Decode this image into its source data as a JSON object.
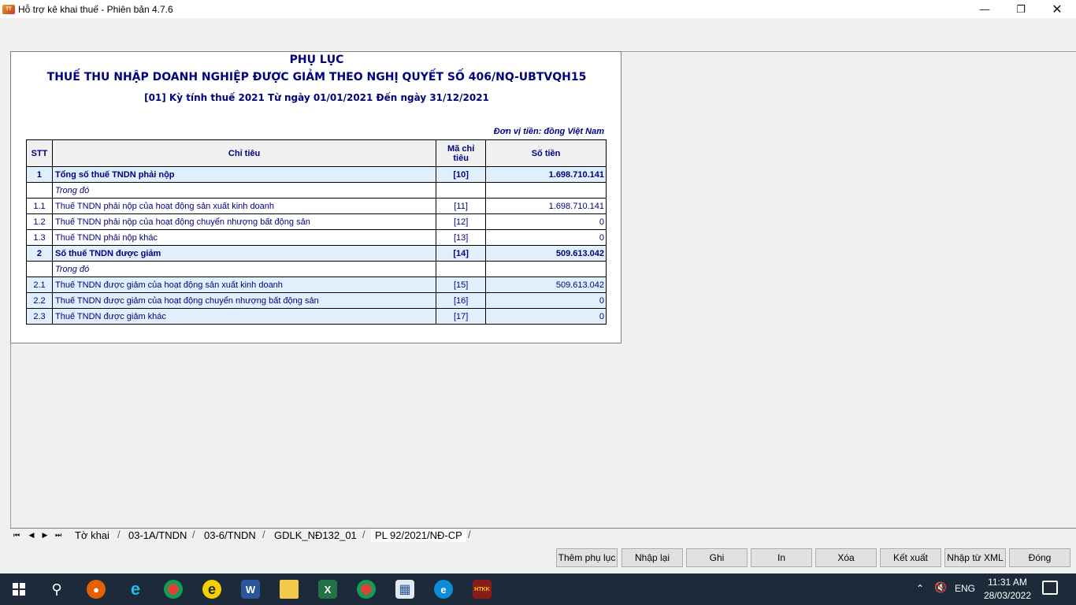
{
  "window": {
    "title": "Hỗ trợ kê khai thuế -  Phiên bản 4.7.6",
    "minimize": "—",
    "restore": "❐",
    "close": "✕"
  },
  "form": {
    "title": "PHỤ LỤC",
    "subtitle": "THUẾ THU NHẬP DOANH NGHIỆP ĐƯỢC GIẢM THEO NGHỊ QUYẾT SỐ 406/NQ-UBTVQH15",
    "period": "[01] Kỳ tính thuế 2021 Từ ngày 01/01/2021 Đến ngày 31/12/2021",
    "currency_note": "Đơn vị tiền: đồng Việt Nam",
    "columns": {
      "stt": "STT",
      "indicator": "Chỉ tiêu",
      "code": "Mã chỉ tiêu",
      "amount": "Số tiền"
    },
    "rows": [
      {
        "stt": "1",
        "label": "Tổng số thuế TNDN phải nộp",
        "code": "[10]",
        "amount": "1.698.710.141"
      },
      {
        "stt": "",
        "label": "Trong đó",
        "code": "",
        "amount": ""
      },
      {
        "stt": "1.1",
        "label": "Thuế TNDN phải nộp của hoạt động sản xuất kinh doanh",
        "code": "[11]",
        "amount": "1.698.710.141"
      },
      {
        "stt": "1.2",
        "label": "Thuế TNDN phải nộp của hoạt động chuyển nhượng bất động sản",
        "code": "[12]",
        "amount": "0"
      },
      {
        "stt": "1.3",
        "label": "Thuế TNDN phải nộp khác",
        "code": "[13]",
        "amount": "0"
      },
      {
        "stt": "2",
        "label": "Số thuế TNDN được giảm",
        "code": "[14]",
        "amount": "509.613.042"
      },
      {
        "stt": "",
        "label": "Trong đó",
        "code": "",
        "amount": ""
      },
      {
        "stt": "2.1",
        "label": "Thuế TNDN được giảm của hoạt động sản xuất kinh doanh",
        "code": "[15]",
        "amount": "509.613.042"
      },
      {
        "stt": "2.2",
        "label": "Thuế TNDN được giảm của hoạt động chuyển nhượng bất động sản",
        "code": "[16]",
        "amount": "0"
      },
      {
        "stt": "2.3",
        "label": "Thuế TNDN được giảm khác",
        "code": "[17]",
        "amount": "0"
      }
    ]
  },
  "tabs": {
    "nav": [
      "⏮",
      "◀",
      "▶",
      "⏭"
    ],
    "items": [
      "Tờ khai",
      "03-1A/TNDN",
      "03-6/TNDN",
      "GDLK_NĐ132_01",
      "PL 92/2021/NĐ-CP"
    ],
    "active": "PL 92/2021/NĐ-CP"
  },
  "actions": {
    "add_appendix": "Thêm phụ lục",
    "re_enter": "Nhập lại",
    "save": "Ghi",
    "print": "In",
    "delete": "Xóa",
    "export": "Kết xuất",
    "import_xml": "Nhập từ XML",
    "close": "Đóng"
  },
  "taskbar": {
    "icons": [
      "start-icon",
      "search-icon",
      "firefox-icon",
      "ie-icon",
      "chrome-icon",
      "e-icon",
      "word-icon",
      "explorer-icon",
      "excel-icon",
      "chrome-x-icon",
      "calculator-icon",
      "edge-icon",
      "htkk-icon"
    ],
    "tray_up": "⌃",
    "volume": "🔇",
    "language": "ENG",
    "time": "11:31 AM",
    "date": "28/03/2022",
    "colors": {
      "taskbar": "#1c2a3a",
      "form_text": "#000080",
      "highlight_row": "#dff0fc"
    }
  }
}
